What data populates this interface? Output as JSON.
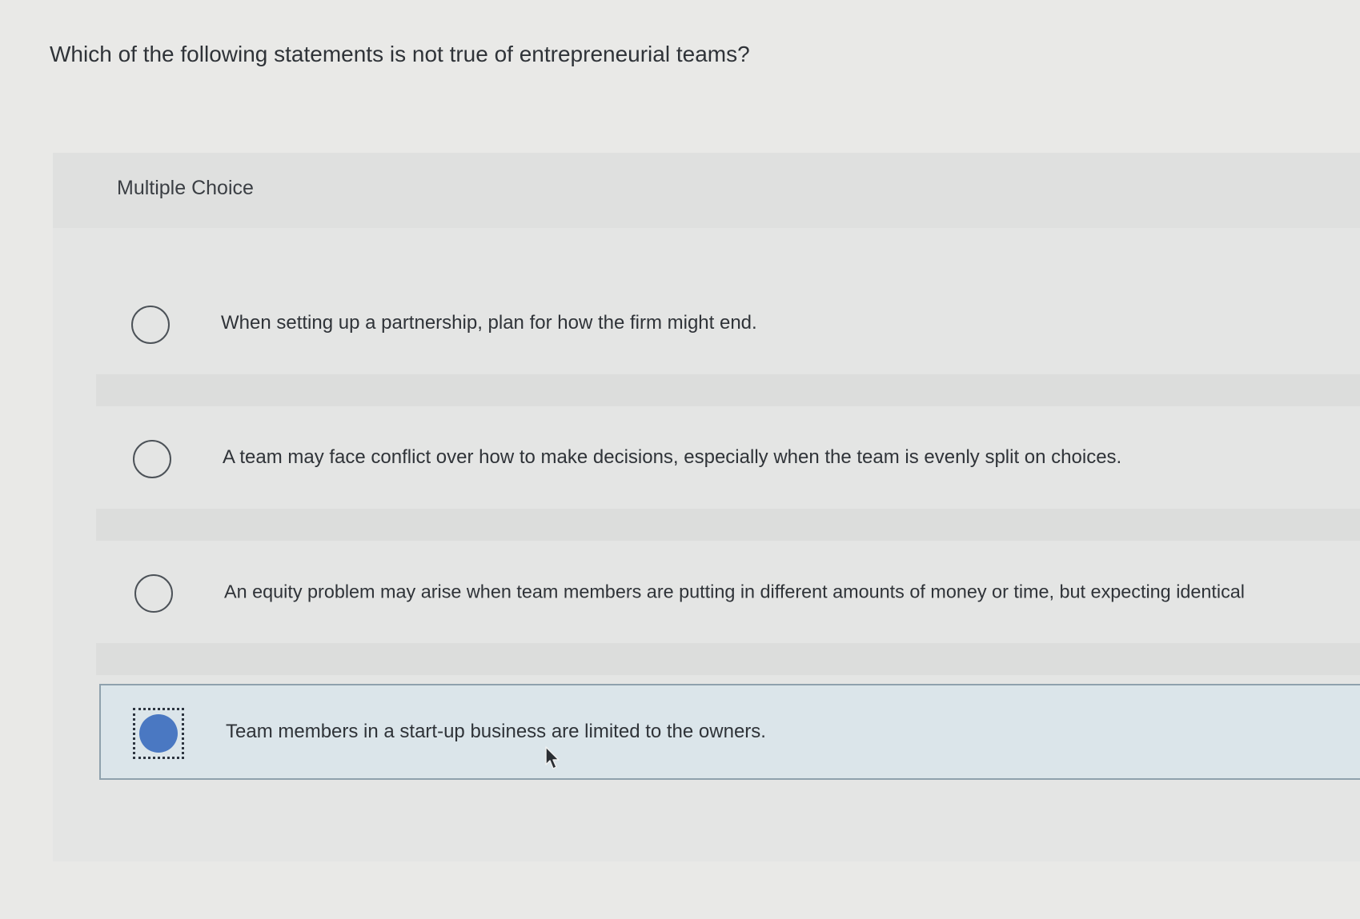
{
  "question": {
    "text": "Which of the following statements is not true of entrepreneurial teams?"
  },
  "panel": {
    "title": "Multiple Choice"
  },
  "options": [
    {
      "label": "When setting up a partnership, plan for how the firm might end.",
      "selected": false
    },
    {
      "label": "A team may face conflict over how to make decisions, especially when the team is evenly split on choices.",
      "selected": false
    },
    {
      "label": "An equity problem may arise when team members are putting in different amounts of money or time, but expecting identical",
      "selected": false
    },
    {
      "label": "Team members in a start-up business are limited to the owners.",
      "selected": true
    }
  ],
  "colors": {
    "selected_radio": "#4a78c2",
    "selected_row_bg": "#dbe5ea",
    "selected_row_border": "#8fa1ad"
  },
  "icons": {
    "cursor": "mouse-pointer-icon"
  }
}
